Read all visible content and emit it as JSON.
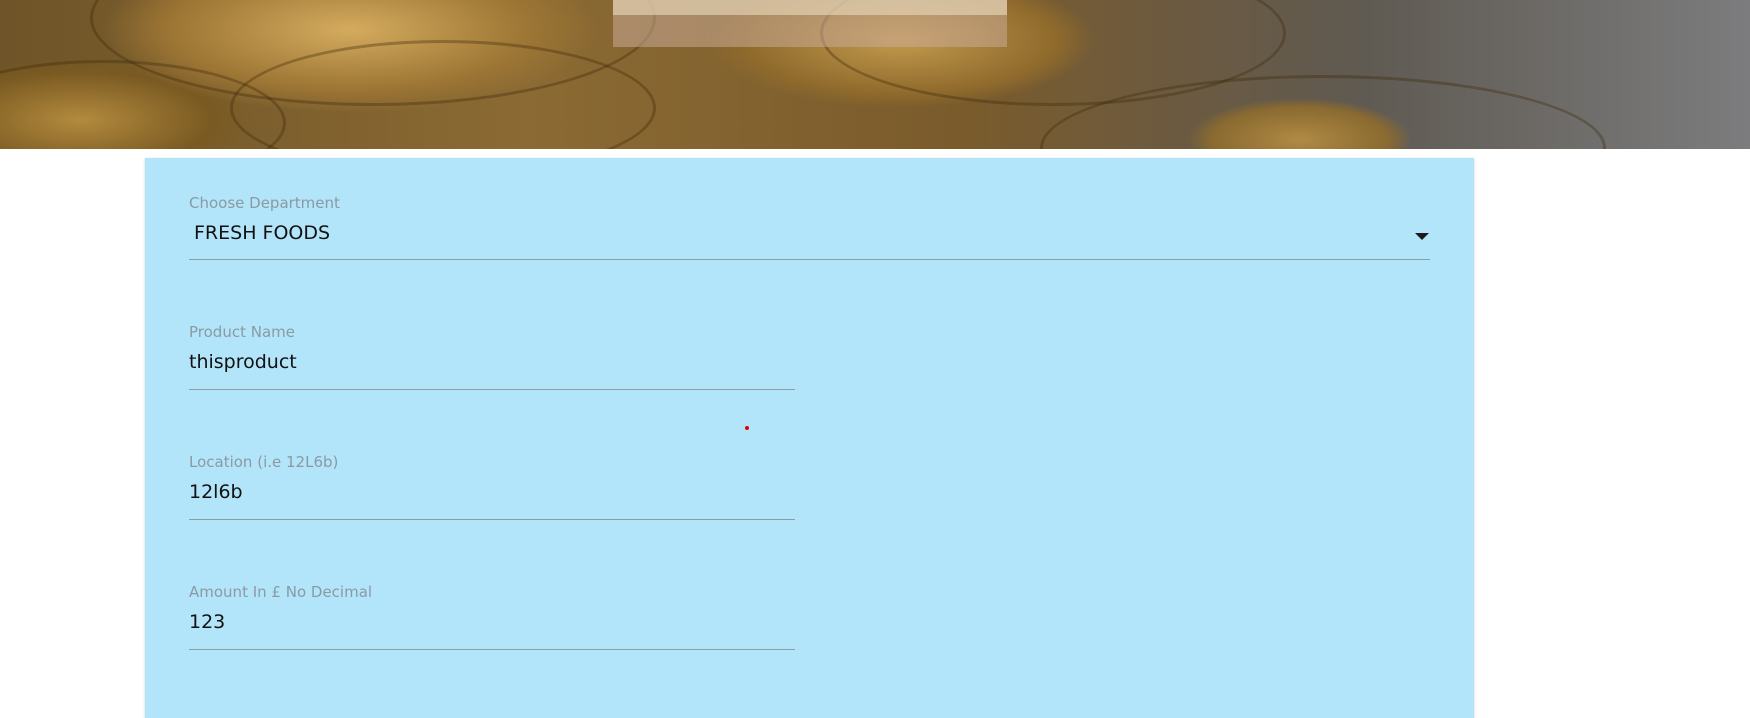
{
  "form": {
    "department": {
      "label": "Choose Department",
      "value": "FRESH FOODS"
    },
    "product_name": {
      "label": "Product Name",
      "value": "thisproduct"
    },
    "location": {
      "label": "Location (i.e 12L6b)",
      "value": "12l6b"
    },
    "amount": {
      "label": "Amount In £ No Decimal",
      "value": "123"
    }
  },
  "colors": {
    "card_background": "#b3e5fa",
    "label": "#8a9aa2",
    "value": "#111111",
    "underline": "#8e9ca3",
    "pointer_dot": "#e00000"
  },
  "icons": {
    "select_caret": "caret-down"
  }
}
